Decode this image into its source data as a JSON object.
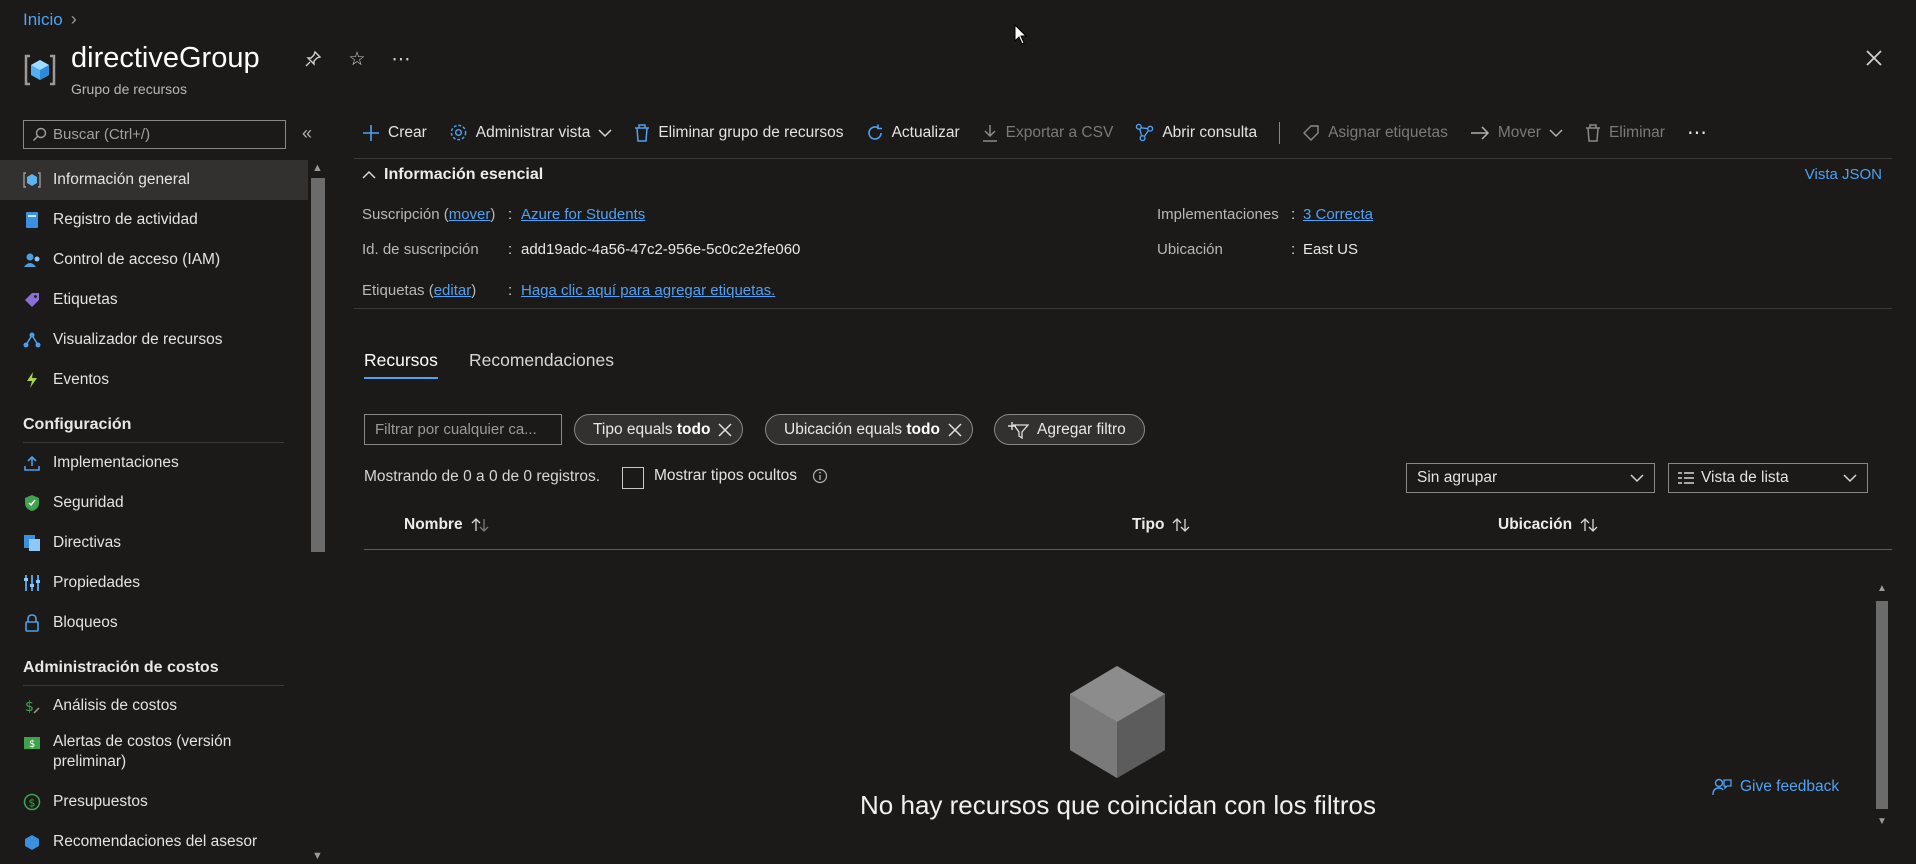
{
  "breadcrumb": {
    "home": "Inicio"
  },
  "resource": {
    "title": "directiveGroup",
    "subtitle": "Grupo de recursos"
  },
  "sidebar": {
    "search_placeholder": "Buscar (Ctrl+/)",
    "items_top": [
      {
        "label": "Información general",
        "icon": "overview-icon"
      },
      {
        "label": "Registro de actividad",
        "icon": "activity-log-icon"
      },
      {
        "label": "Control de acceso (IAM)",
        "icon": "iam-icon"
      },
      {
        "label": "Etiquetas",
        "icon": "tag-icon"
      },
      {
        "label": "Visualizador de recursos",
        "icon": "resource-visualizer-icon"
      },
      {
        "label": "Eventos",
        "icon": "lightning-icon"
      }
    ],
    "section_config": "Configuración",
    "items_config": [
      {
        "label": "Implementaciones",
        "icon": "deployments-icon"
      },
      {
        "label": "Seguridad",
        "icon": "security-shield-icon"
      },
      {
        "label": "Directivas",
        "icon": "policies-icon"
      },
      {
        "label": "Propiedades",
        "icon": "properties-icon"
      },
      {
        "label": "Bloqueos",
        "icon": "lock-icon"
      }
    ],
    "section_costs": "Administración de costos",
    "items_costs": [
      {
        "label": "Análisis de costos",
        "icon": "cost-analysis-icon"
      },
      {
        "label": "Alertas de costos (versión preliminar)",
        "icon": "cost-alerts-icon"
      },
      {
        "label": "Presupuestos",
        "icon": "budgets-icon"
      },
      {
        "label": "Recomendaciones del asesor",
        "icon": "advisor-icon"
      }
    ]
  },
  "toolbar": {
    "create": "Crear",
    "manage_view": "Administrar vista",
    "delete_group": "Eliminar grupo de recursos",
    "refresh": "Actualizar",
    "export_csv": "Exportar a CSV",
    "open_query": "Abrir consulta",
    "assign_tags": "Asignar etiquetas",
    "move": "Mover",
    "delete": "Eliminar"
  },
  "essentials": {
    "title": "Información esencial",
    "json_view": "Vista JSON",
    "subscription_label": "Suscripción",
    "move_link": "mover",
    "subscription_value": "Azure for Students",
    "subscription_id_label": "Id. de suscripción",
    "subscription_id_value": "add19adc-4a56-47c2-956e-5c0c2e2fe060",
    "tags_label": "Etiquetas",
    "edit_link": "editar",
    "tags_value": "Haga clic aquí para agregar etiquetas.",
    "deployments_label": "Implementaciones",
    "deployments_value": "3 Correcta",
    "location_label": "Ubicación",
    "location_value": "East US"
  },
  "tabs": {
    "resources": "Recursos",
    "recommendations": "Recomendaciones"
  },
  "filters": {
    "input_placeholder": "Filtrar por cualquier ca...",
    "type_prefix": "Tipo equals",
    "type_value": "todo",
    "location_prefix": "Ubicación equals",
    "location_value": "todo",
    "add_filter": "Agregar filtro"
  },
  "list": {
    "count_text": "Mostrando de 0 a 0 de 0 registros.",
    "show_hidden": "Mostrar tipos ocultos",
    "grouping": "Sin agrupar",
    "view_mode": "Vista de lista",
    "columns": [
      "Nombre",
      "Tipo",
      "Ubicación"
    ],
    "empty_message": "No hay recursos que coincidan con los filtros",
    "feedback": "Give feedback"
  }
}
